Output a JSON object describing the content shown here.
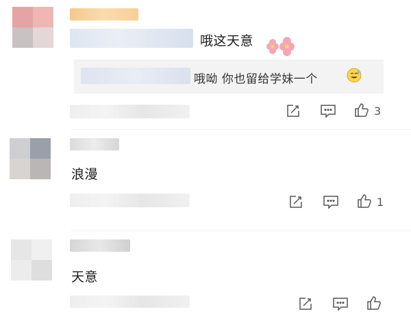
{
  "comments": [
    {
      "text": "哦这天意",
      "reply_quote": "哦呦  你也留给学妹一个",
      "likes": "3"
    },
    {
      "text": "浪漫",
      "likes": "1"
    },
    {
      "text": "天意",
      "likes": ""
    }
  ],
  "icons": {
    "reply": "reply-edit-icon",
    "comment": "comment-icon",
    "like": "thumbs-up-icon",
    "emoji_flower": "flower-emoji",
    "emoji_face": "sweat-smile-emoji"
  },
  "colors": {
    "icon": "#555555",
    "divider": "#eeeeee",
    "quote_bg": "#f3f3f3",
    "flower": "#f4a6b8"
  }
}
